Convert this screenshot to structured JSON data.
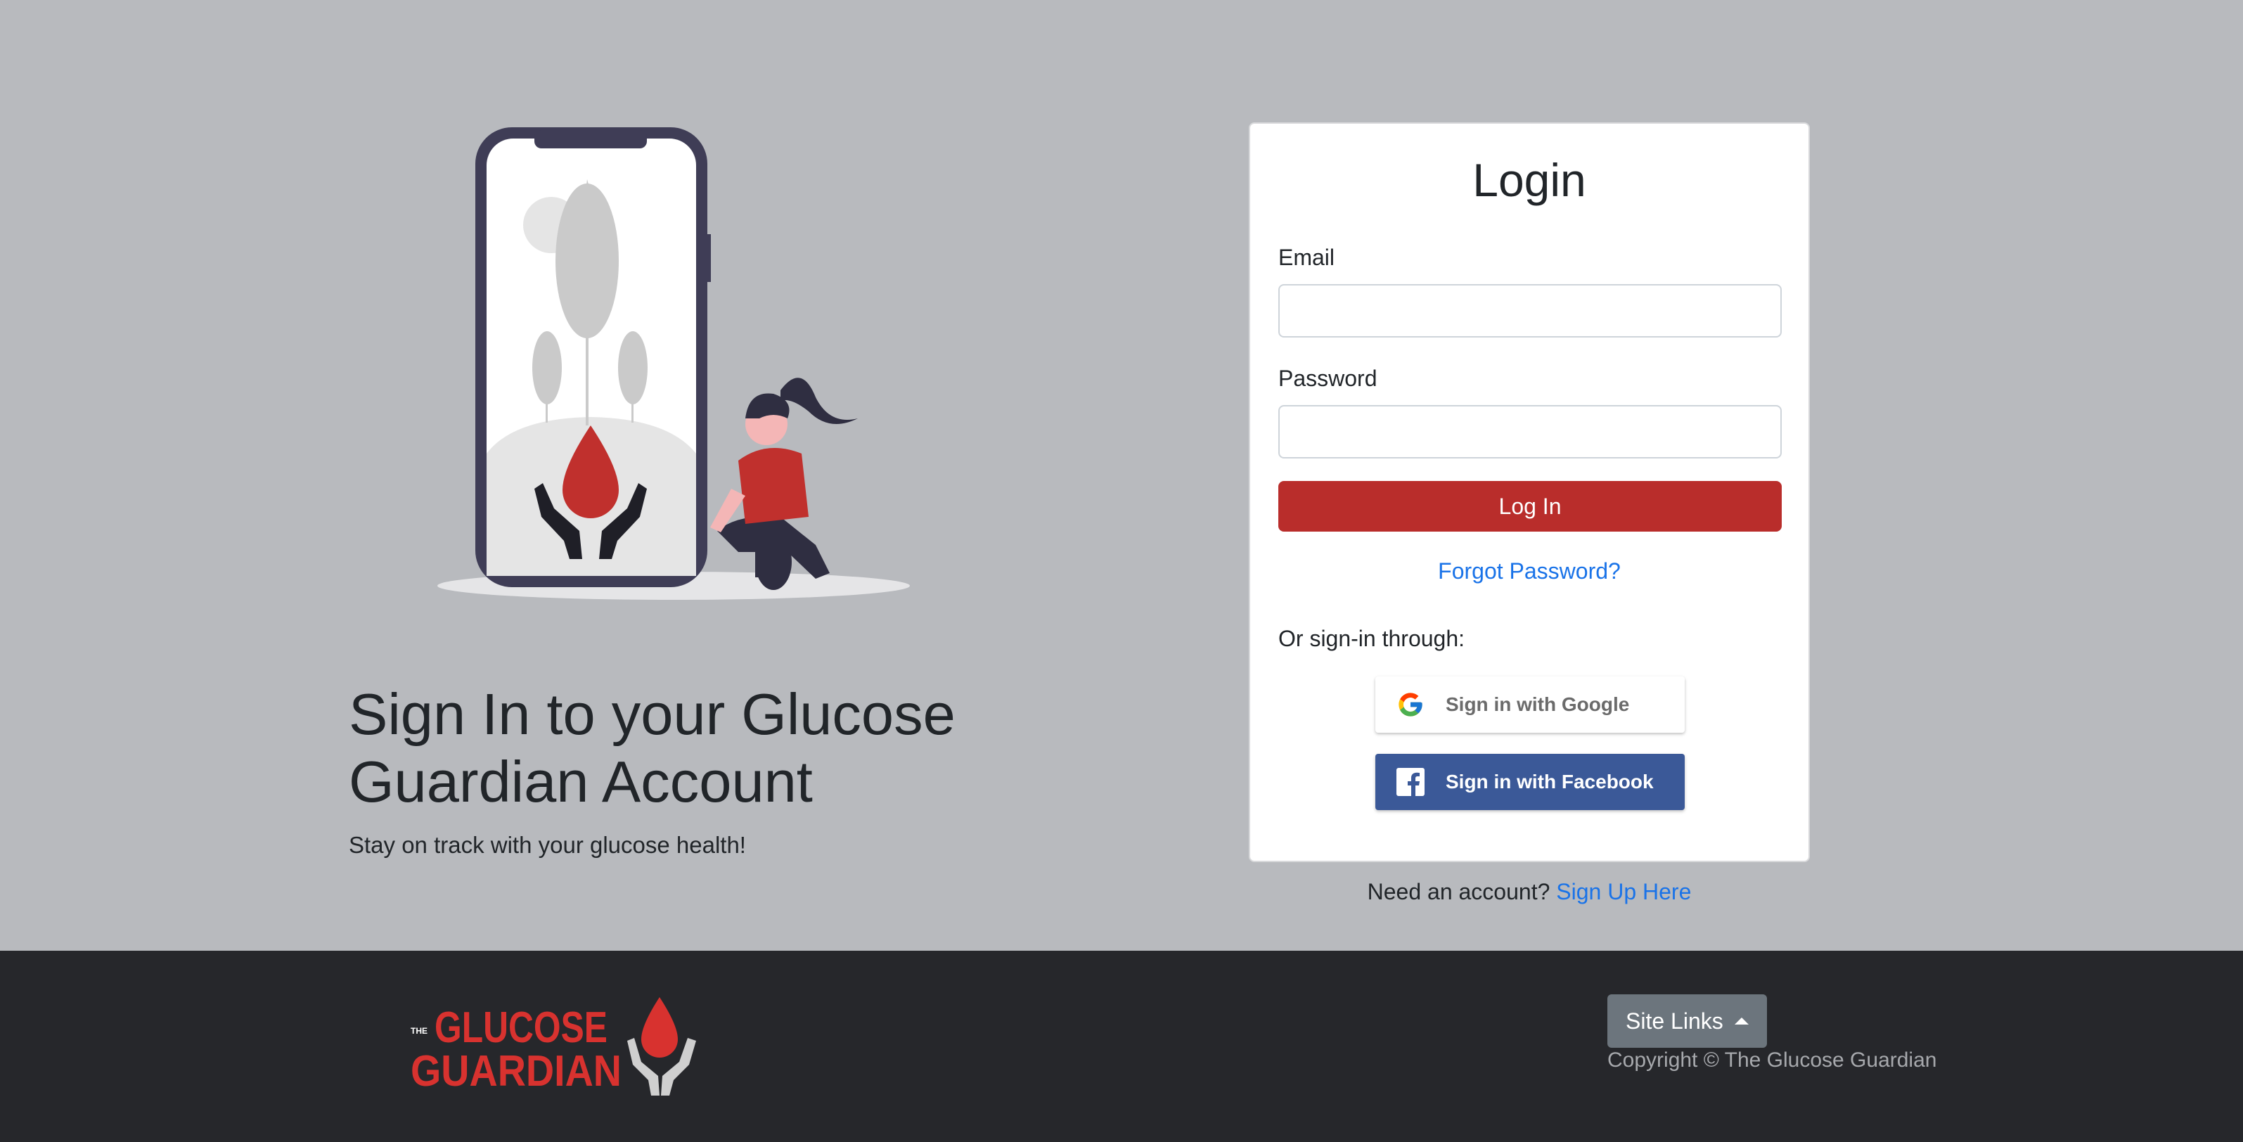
{
  "hero": {
    "title": "Sign In to your Glucose Guardian Account",
    "subtitle": "Stay on track with your glucose health!"
  },
  "login_card": {
    "title": "Login",
    "email_label": "Email",
    "email_value": "",
    "password_label": "Password",
    "password_value": "",
    "submit_label": "Log In",
    "forgot_label": "Forgot Password?",
    "or_text": "Or sign-in through:",
    "google_label": "Sign in with Google",
    "facebook_label": "Sign in with Facebook"
  },
  "signup": {
    "prompt": "Need an account?",
    "link_label": "Sign Up Here"
  },
  "footer": {
    "logo_text_top": "THE",
    "logo_text_line1": "GLUCOSE",
    "logo_text_line2": "GUARDIAN",
    "site_links_label": "Site Links",
    "copyright": "Copyright © The Glucose Guardian"
  },
  "colors": {
    "background": "#b8babe",
    "brand_red": "#b92d2b",
    "link_blue": "#1a73e8",
    "facebook_blue": "#3b5998",
    "footer": "#26272b"
  },
  "icons": [
    "phone-illustration",
    "blood-drop-icon",
    "google-icon",
    "facebook-icon",
    "caret-up-icon"
  ]
}
